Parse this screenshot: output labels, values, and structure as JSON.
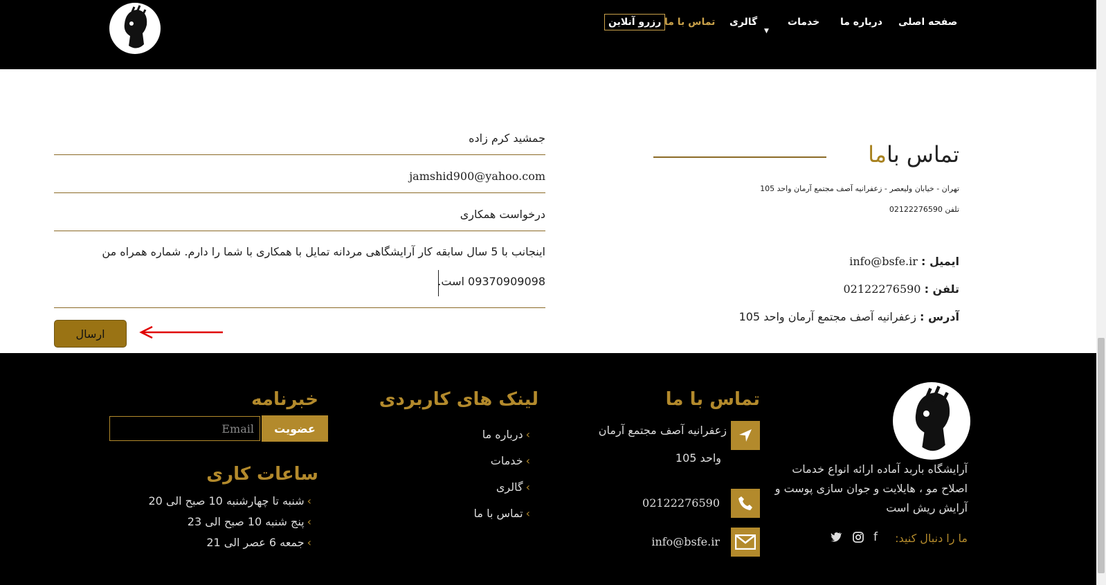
{
  "header": {
    "nav": [
      "صفحه اصلی",
      "درباره ما",
      "خدمات",
      "گالری",
      "تماس با ما"
    ],
    "reserve_label": "رزرو آنلاین"
  },
  "form": {
    "name_value": "جمشید کرم زاده",
    "email_value": "jamshid900@yahoo.com",
    "subject_value": "درخواست همکاری",
    "message_line1": "اینجانب با 5 سال سابقه کار آرایشگاهی مردانه تمایل با همکاری با شما را دارم. شماره همراه من",
    "message_line2": "09370909098 است.",
    "submit_label": "ارسال"
  },
  "contact": {
    "title_main": "تماس با",
    "title_accent": "ما",
    "address_small": "تهران - خیابان ولیعصر - زعفرانیه آصف مجتمع آرمان واحد 105",
    "phone_small": "تلفن 02122276590",
    "email_label": "ایمیل :",
    "email_value": "info@bsfe.ir",
    "phone_label": "تلفن :",
    "phone_value": "02122276590",
    "address_label": "آدرس :",
    "address_value": "زعفرانیه آصف مجتمع آرمان واحد 105"
  },
  "footer": {
    "about_text": [
      "آرایشگاه باربد آماده ارائه انواع خدمات",
      "اصلاح مو ، هایلایت و جوان سازی پوست و",
      "آرایش ریش است"
    ],
    "follow_label": "ما را دنبال کنید:",
    "contact_heading": "تماس با ما",
    "contact_address_line1": "زعفرانیه آصف مجتمع آرمان",
    "contact_address_line2": "واحد 105",
    "contact_phone": "02122276590",
    "contact_email": "info@bsfe.ir",
    "links_heading": "لینک های کاربردی",
    "links": [
      "درباره ما",
      "خدمات",
      "گالری",
      "تماس با ما"
    ],
    "newsletter_heading": "خبرنامه",
    "email_placeholder": "Email",
    "join_label": "عضویت",
    "hours_heading": "ساعات کاری",
    "hours": [
      "شنبه تا چهارشنبه 10 صبح الی 20",
      "پنج شنبه 10 صبح الی 23",
      "جمعه 6 عصر الی 21"
    ]
  },
  "colors": {
    "gold": "#b38a2c",
    "button_gold": "#9a7314",
    "arrow_red": "#e00000"
  },
  "icons": [
    "barber-logo-icon",
    "dropdown-caret-icon",
    "location-arrow-icon",
    "phone-icon",
    "envelope-icon",
    "facebook-icon",
    "instagram-icon",
    "twitter-icon",
    "chevron-icon",
    "red-arrow-icon"
  ]
}
